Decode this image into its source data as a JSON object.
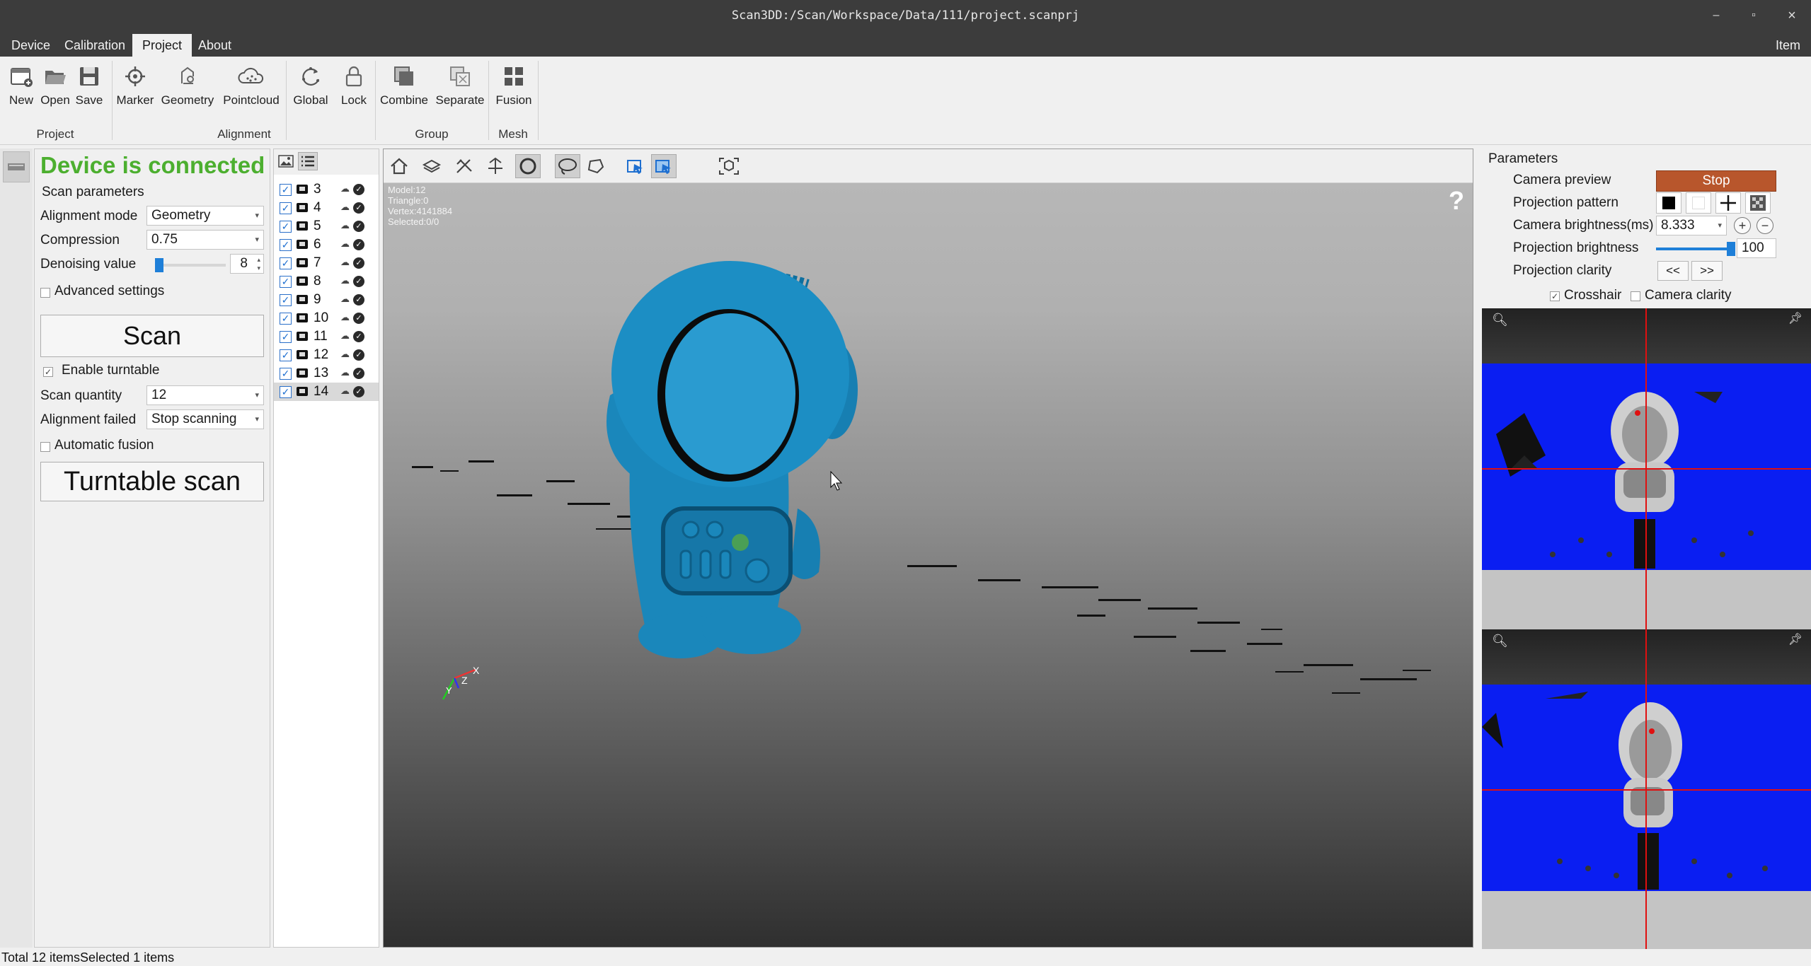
{
  "window": {
    "title": "Scan3DD:/Scan/Workspace/Data/111/project.scanprj",
    "min": "–",
    "restore": "▫",
    "close": "×"
  },
  "menu": {
    "items": [
      "Device",
      "Calibration",
      "Project",
      "About"
    ],
    "active": "Project",
    "right_item": "Item ·"
  },
  "ribbon": {
    "buttons": {
      "new": "New",
      "open": "Open",
      "save": "Save",
      "marker": "Marker",
      "geometry": "Geometry",
      "pointcloud": "Pointcloud",
      "global": "Global",
      "lock": "Lock",
      "combine": "Combine",
      "separate": "Separate",
      "fusion": "Fusion"
    },
    "groups": {
      "project": "Project",
      "alignment": "Alignment",
      "group": "Group",
      "mesh": "Mesh"
    }
  },
  "left_panel": {
    "status": "Device is connected",
    "scan_parameters": "Scan parameters",
    "alignment_mode_label": "Alignment mode",
    "alignment_mode_value": "Geometry",
    "compression_label": "Compression",
    "compression_value": "0.75",
    "denoising_label": "Denoising value",
    "denoising_value": "8",
    "advanced_settings": "Advanced settings",
    "scan_button": "Scan",
    "enable_turntable": "Enable turntable",
    "scan_quantity_label": "Scan quantity",
    "scan_quantity_value": "12",
    "alignment_failed_label": "Alignment failed",
    "alignment_failed_value": "Stop scanning",
    "automatic_fusion": "Automatic fusion",
    "turntable_button": "Turntable scan"
  },
  "model_list": {
    "items": [
      "3",
      "4",
      "5",
      "6",
      "7",
      "8",
      "9",
      "10",
      "11",
      "12",
      "13",
      "14"
    ],
    "selected": "14"
  },
  "viewport": {
    "stats": {
      "model": "Model:12",
      "triangle": "Triangle:0",
      "vertex": "Vertex:4141884",
      "selected": "Selected:0/0"
    },
    "help": "?",
    "axis_x": "X",
    "axis_y": "Y",
    "axis_z": "Z"
  },
  "parameters": {
    "title": "Parameters",
    "camera_preview_label": "Camera preview",
    "camera_preview_button": "Stop",
    "projection_pattern_label": "Projection pattern",
    "camera_brightness_label": "Camera brightness(ms)",
    "camera_brightness_value": "8.333",
    "projection_brightness_label": "Projection brightness",
    "projection_brightness_value": "100",
    "projection_clarity_label": "Projection clarity",
    "clarity_prev": "<<",
    "clarity_next": ">>",
    "crosshair_label": "Crosshair",
    "camera_clarity_label": "Camera clarity"
  },
  "status_bar": {
    "text": "Total 12 itemsSelected 1 items"
  },
  "colors": {
    "connected": "#4caf2f",
    "stop_button": "#b8562c",
    "model": "#1a8fc4",
    "camera_bg": "#0a1ef2",
    "crosshair": "#e01010",
    "accent": "#1e7fd8"
  }
}
